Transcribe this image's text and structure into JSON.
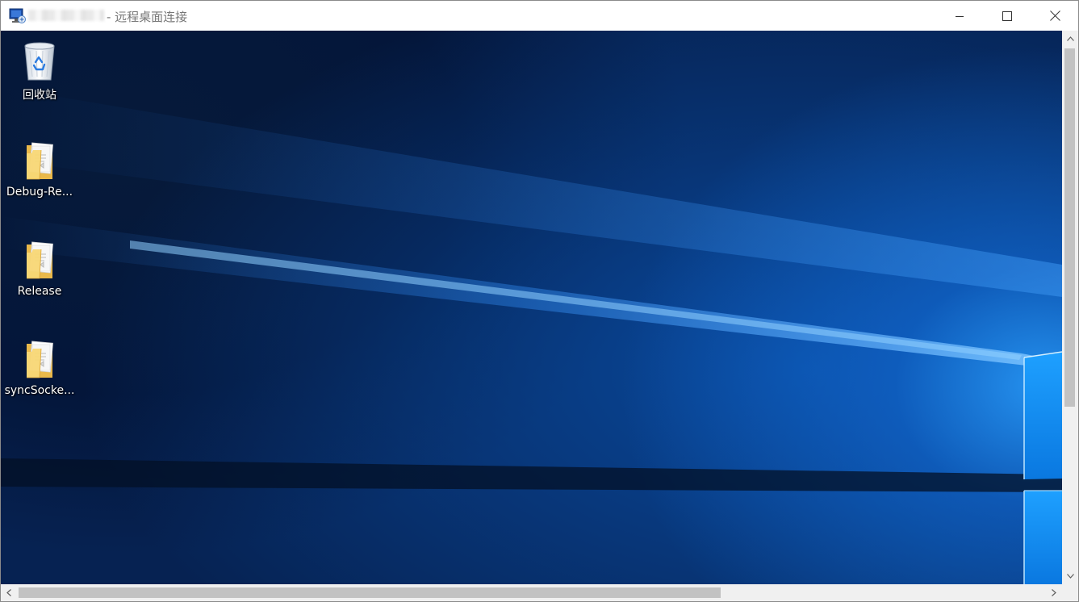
{
  "window": {
    "title": "- 远程桌面连接",
    "app_icon": "remote-desktop-icon"
  },
  "caption_buttons": {
    "minimize": "minimize-icon",
    "maximize": "maximize-icon",
    "close": "close-icon"
  },
  "desktop": {
    "icons": [
      {
        "label": "回收站",
        "icon": "recycle-bin-icon"
      },
      {
        "label": "Debug-Re...",
        "icon": "folder-icon"
      },
      {
        "label": "Release",
        "icon": "folder-icon"
      },
      {
        "label": "syncSocke...",
        "icon": "folder-icon"
      }
    ]
  },
  "scrollbars": {
    "vertical": {
      "up": "chevron-up-icon",
      "down": "chevron-down-icon"
    },
    "horizontal": {
      "left": "chevron-left-icon",
      "right": "chevron-right-icon"
    }
  }
}
